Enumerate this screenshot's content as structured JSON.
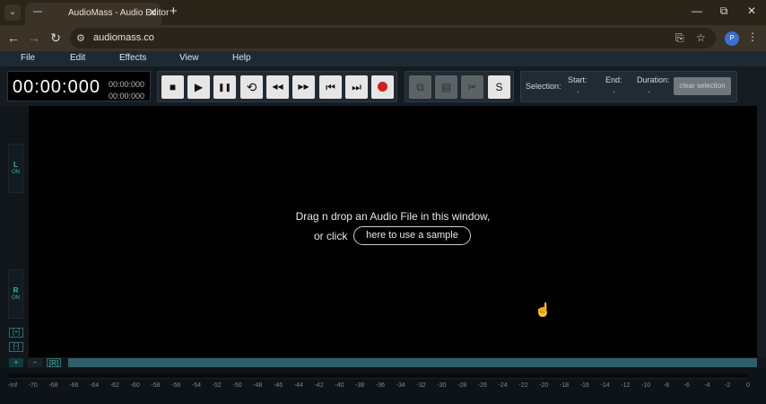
{
  "browser": {
    "tab_title": "AudioMass - Audio Editor",
    "tab_close": "✕",
    "new_tab": "+",
    "tab_menu": "⌄",
    "url": "audiomass.co",
    "profile_initial": "P",
    "window_controls": {
      "minimize": "—",
      "maximize": "⧉",
      "close": "✕"
    },
    "nav": {
      "back": "←",
      "forward": "→",
      "reload": "↻"
    }
  },
  "menubar": {
    "items": [
      "File",
      "Edit",
      "Effects",
      "View",
      "Help"
    ]
  },
  "time": {
    "main": "00:00:000",
    "start": "00:00:000",
    "end": "00:00:000"
  },
  "transport": {
    "stop": "■",
    "play": "▶",
    "pause": "❚❚",
    "loop": "⟲",
    "rewind": "◀◀",
    "forward": "▶▶",
    "skip_start": "⏮",
    "skip_end": "⏭",
    "record": ""
  },
  "edit_tools": {
    "copy": "⧉",
    "paste": "▤",
    "cut": "✂",
    "silence": "S"
  },
  "selection": {
    "label": "Selection:",
    "start_label": "Start:",
    "start_value": "-",
    "end_label": "End:",
    "end_value": "-",
    "duration_label": "Duration:",
    "duration_value": "-",
    "clear_label": "clear selection"
  },
  "channels": {
    "left": {
      "letter": "L",
      "status": "ON"
    },
    "right": {
      "letter": "R",
      "status": "ON"
    }
  },
  "dropzone": {
    "line1": "Drag n drop an Audio File in this window,",
    "or_click": "or click",
    "sample_button": "here to use a sample"
  },
  "zoom": {
    "zoom_in": "[+]",
    "zoom_out": "[-]",
    "plus": "+",
    "minus": "−",
    "fit": "[R]"
  },
  "meter_labels": [
    "-Inf",
    "-70",
    "-68",
    "-66",
    "-64",
    "-62",
    "-60",
    "-58",
    "-56",
    "-54",
    "-52",
    "-50",
    "-48",
    "-46",
    "-44",
    "-42",
    "-40",
    "-38",
    "-36",
    "-34",
    "-32",
    "-30",
    "-28",
    "-26",
    "-24",
    "-22",
    "-20",
    "-18",
    "-16",
    "-14",
    "-12",
    "-10",
    "-8",
    "-6",
    "-4",
    "-2",
    "0"
  ],
  "colors": {
    "accent_teal": "#23c4a7",
    "scroll_track": "#2d5f6b",
    "record_red": "#d21f1f",
    "menubar_bg": "#1e2a33"
  },
  "icons": [
    "site-info-icon",
    "install-icon",
    "bookmark-star-icon",
    "kebab-menu-icon",
    "mouse-cursor-icon"
  ]
}
